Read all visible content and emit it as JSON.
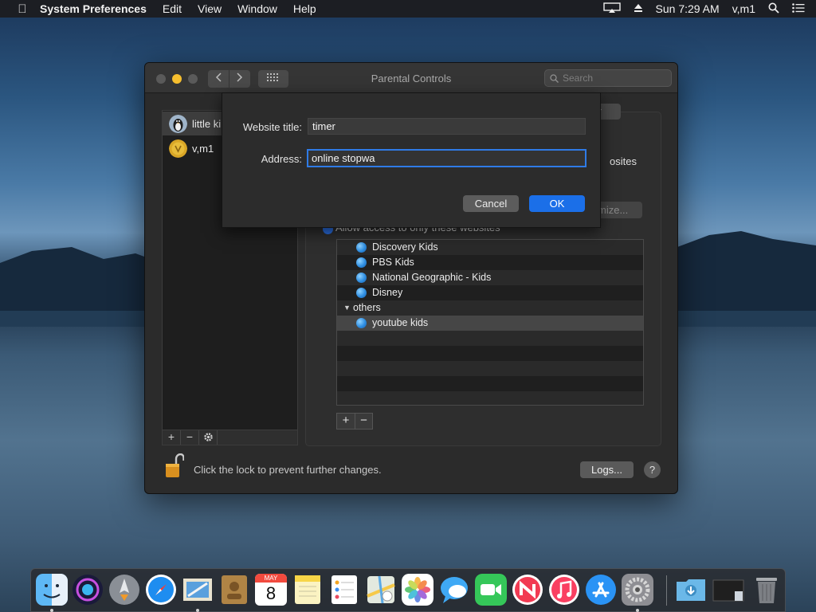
{
  "menubar": {
    "app_name": "System Preferences",
    "items": [
      "Edit",
      "View",
      "Window",
      "Help"
    ],
    "clock": "Sun 7:29 AM",
    "user": "v,m1"
  },
  "window": {
    "title": "Parental Controls",
    "search_placeholder": "Search"
  },
  "users": [
    {
      "name": "little kids",
      "visible_name": "little ki",
      "selected": true
    },
    {
      "name": "v,m1",
      "visible_name": "v,m1",
      "selected": false
    }
  ],
  "panel": {
    "tab_visible": "er",
    "websites_fragment": "osites",
    "customize_fragment": "mize...",
    "allow_only_label": "Allow access to only these websites",
    "sites": [
      {
        "label": "Discovery Kids"
      },
      {
        "label": "PBS Kids"
      },
      {
        "label": "National Geographic - Kids"
      },
      {
        "label": "Disney"
      }
    ],
    "group": {
      "label": "others",
      "expanded": true,
      "sites": [
        {
          "label": "youtube kids",
          "selected": true
        }
      ]
    },
    "add_label": "+",
    "remove_label": "−"
  },
  "footer": {
    "lock_text": "Click the lock to prevent further changes.",
    "logs_label": "Logs...",
    "help_label": "?"
  },
  "sheet": {
    "title_label": "Website title:",
    "title_value": "timer",
    "address_label": "Address:",
    "address_value": "online stopwa",
    "cancel_label": "Cancel",
    "ok_label": "OK"
  },
  "colors": {
    "accent": "#1b6fe8",
    "window_bg": "#2b2b2b"
  },
  "dock": {
    "apps": [
      "finder-icon",
      "siri-icon",
      "launchpad-icon",
      "safari-icon",
      "mail-icon",
      "contacts-icon",
      "calendar-icon",
      "notes-icon",
      "reminders-icon",
      "maps-icon",
      "photos-icon",
      "messages-icon",
      "facetime-icon",
      "news-icon",
      "music-icon",
      "app-store-icon",
      "system-preferences-icon",
      "downloads-icon",
      "screenshot-icon",
      "trash-icon"
    ],
    "calendar_month": "MAY",
    "calendar_day": "8"
  }
}
